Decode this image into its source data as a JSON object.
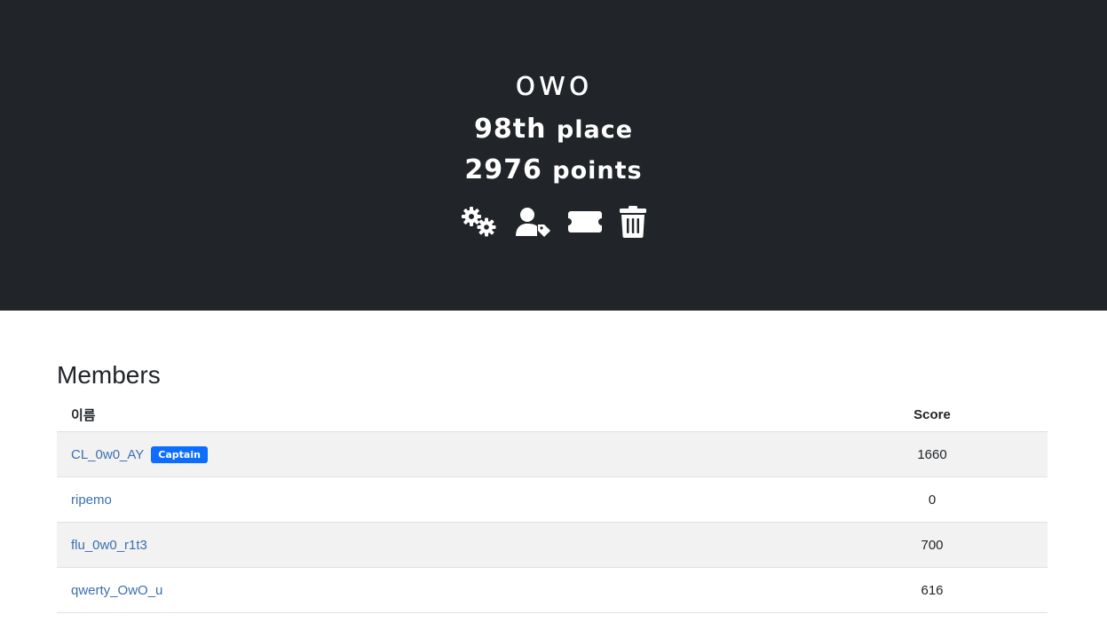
{
  "team": {
    "name": "owo",
    "place_number": "98th",
    "place_word": "place",
    "points_number": "2976",
    "points_word": "points"
  },
  "actions": [
    {
      "icon": "gears-icon"
    },
    {
      "icon": "user-tag-icon"
    },
    {
      "icon": "ticket-icon"
    },
    {
      "icon": "trash-icon"
    }
  ],
  "members": {
    "title": "Members",
    "columns": {
      "name": "이름",
      "score": "Score"
    },
    "rows": [
      {
        "name": "CL_0w0_AY",
        "badge": "Captain",
        "score": "1660"
      },
      {
        "name": "ripemo",
        "badge": "",
        "score": "0"
      },
      {
        "name": "flu_0w0_r1t3",
        "badge": "",
        "score": "700"
      },
      {
        "name": "qwerty_OwO_u",
        "badge": "",
        "score": "616"
      }
    ]
  },
  "colors": {
    "hero_bg": "#212529",
    "link": "#3a6fb0",
    "badge": "#0d6efd",
    "row_stripe": "#f2f2f2"
  }
}
